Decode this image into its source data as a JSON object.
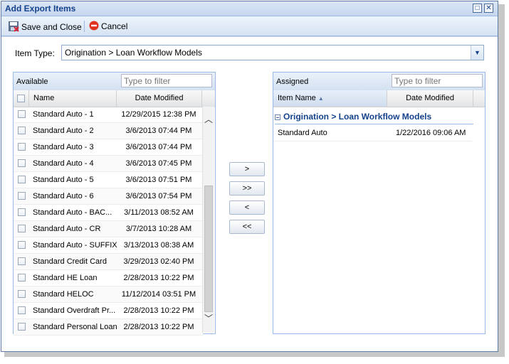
{
  "window": {
    "title": "Add Export Items"
  },
  "toolbar": {
    "save_label": "Save and Close",
    "cancel_label": "Cancel"
  },
  "item_type": {
    "label": "Item Type:",
    "value": "Origination > Loan Workflow Models"
  },
  "available": {
    "title": "Available",
    "filter_placeholder": "Type to filter",
    "columns": {
      "name": "Name",
      "date": "Date Modified"
    },
    "rows": [
      {
        "name": "Standard Auto - 1",
        "date": "12/29/2015 12:38 PM"
      },
      {
        "name": "Standard Auto - 2",
        "date": "3/6/2013 07:44 PM"
      },
      {
        "name": "Standard Auto - 3",
        "date": "3/6/2013 07:44 PM"
      },
      {
        "name": "Standard Auto - 4",
        "date": "3/6/2013 07:45 PM"
      },
      {
        "name": "Standard Auto - 5",
        "date": "3/6/2013 07:51 PM"
      },
      {
        "name": "Standard Auto - 6",
        "date": "3/6/2013 07:54 PM"
      },
      {
        "name": "Standard Auto - BAC...",
        "date": "3/11/2013 08:52 AM"
      },
      {
        "name": "Standard Auto - CR",
        "date": "3/7/2013 10:28 AM"
      },
      {
        "name": "Standard Auto - SUFFIX",
        "date": "3/13/2013 08:38 AM"
      },
      {
        "name": "Standard Credit Card",
        "date": "3/29/2013 02:40 PM"
      },
      {
        "name": "Standard HE Loan",
        "date": "2/28/2013 10:22 PM"
      },
      {
        "name": "Standard HELOC",
        "date": "11/12/2014 03:51 PM"
      },
      {
        "name": "Standard Overdraft Pr...",
        "date": "2/28/2013 10:22 PM"
      },
      {
        "name": "Standard Personal Loan",
        "date": "2/28/2013 10:22 PM"
      }
    ]
  },
  "move_buttons": {
    "add": ">",
    "add_all": ">>",
    "remove": "<",
    "remove_all": "<<"
  },
  "assigned": {
    "title": "Assigned",
    "filter_placeholder": "Type to filter",
    "columns": {
      "name": "Item Name",
      "date": "Date Modified"
    },
    "group": "Origination > Loan Workflow Models",
    "rows": [
      {
        "name": "Standard Auto",
        "date": "1/22/2016 09:06 AM"
      }
    ]
  }
}
